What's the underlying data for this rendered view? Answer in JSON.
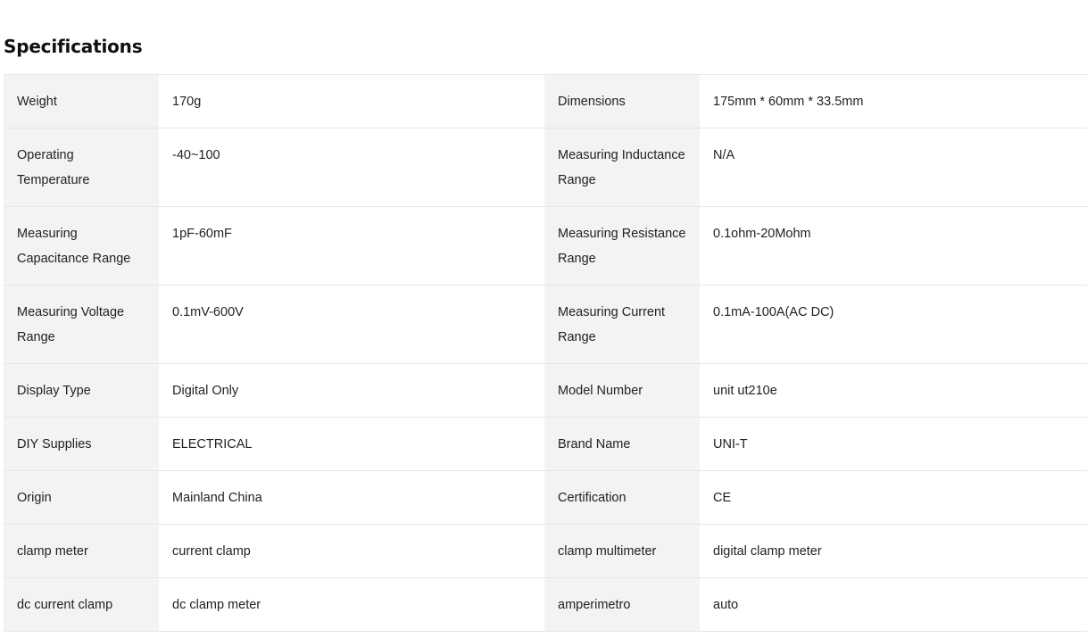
{
  "section": {
    "title": "Specifications"
  },
  "specs": [
    {
      "left_label": "Weight",
      "left_value": "170g",
      "right_label": "Dimensions",
      "right_value": "175mm * 60mm * 33.5mm"
    },
    {
      "left_label": "Operating Temperature",
      "left_value": "-40~100",
      "right_label": "Measuring Inductance Range",
      "right_value": "N/A"
    },
    {
      "left_label": "Measuring Capacitance Range",
      "left_value": "1pF-60mF",
      "right_label": "Measuring Resistance Range",
      "right_value": "0.1ohm-20Mohm"
    },
    {
      "left_label": "Measuring Voltage Range",
      "left_value": "0.1mV-600V",
      "right_label": "Measuring Current Range",
      "right_value": "0.1mA-100A(AC DC)"
    },
    {
      "left_label": "Display Type",
      "left_value": "Digital Only",
      "right_label": "Model Number",
      "right_value": "unit ut210e"
    },
    {
      "left_label": "DIY Supplies",
      "left_value": "ELECTRICAL",
      "right_label": "Brand Name",
      "right_value": "UNI-T"
    },
    {
      "left_label": "Origin",
      "left_value": "Mainland China",
      "right_label": "Certification",
      "right_value": "CE"
    },
    {
      "left_label": "clamp meter",
      "left_value": "current clamp",
      "right_label": "clamp multimeter",
      "right_value": "digital clamp meter"
    },
    {
      "left_label": "dc current clamp",
      "left_value": "dc clamp meter",
      "right_label": "amperimetro",
      "right_value": "auto"
    }
  ]
}
